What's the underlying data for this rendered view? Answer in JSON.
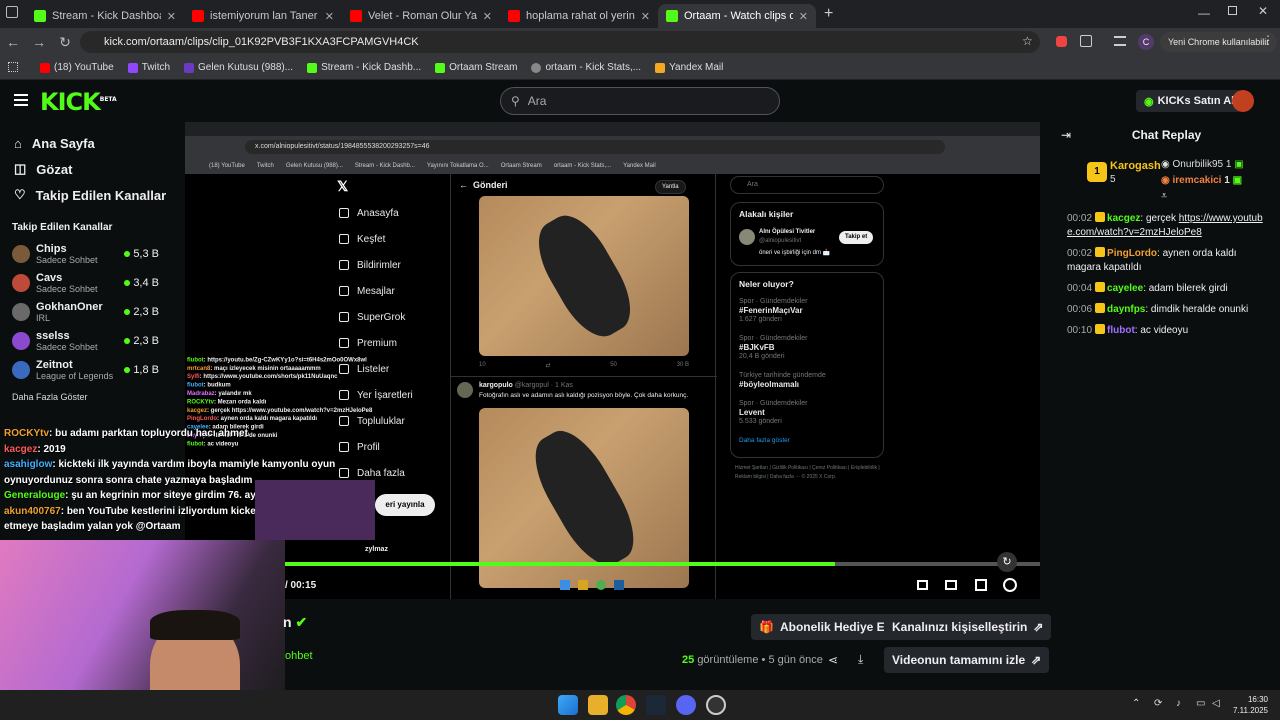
{
  "browser": {
    "tabs": [
      {
        "title": "Stream - Kick Dashboard",
        "color": "#53fc18"
      },
      {
        "title": "istemiyorum lan Taner Tolga Ta",
        "color": "#ff0000"
      },
      {
        "title": "Velet - Roman Olur Yazsam Sen",
        "color": "#ff0000"
      },
      {
        "title": "hoplama rahat ol yerinde otur",
        "color": "#ff0000"
      },
      {
        "title": "Ortaam - Watch clips on Kick",
        "color": "#53fc18"
      }
    ],
    "url": "kick.com/ortaam/clips/clip_01K92PVB3F1KXA3FCPAMGVH4CK",
    "profile_letter": "C",
    "update_label": "Yeni Chrome kullanılabilir",
    "bookmarks": [
      "(18) YouTube",
      "Twitch",
      "Gelen Kutusu (988)...",
      "Stream - Kick Dashb...",
      "Ortaam Stream",
      "ortaam - Kick Stats,...",
      "Yandex Mail"
    ]
  },
  "kick": {
    "logo": "KICK",
    "logo_sup": "BETA",
    "search_placeholder": "Ara",
    "kicks_button": "KICKs Satın Al"
  },
  "sidebar": {
    "nav": [
      "Ana Sayfa",
      "Gözat",
      "Takip Edilen Kanallar"
    ],
    "section_title": "Takip Edilen Kanallar",
    "channels": [
      {
        "name": "Chips",
        "category": "Sadece Sohbet",
        "viewers": "5,3 B",
        "color": "#7a5a3a"
      },
      {
        "name": "Cavs",
        "category": "Sadece Sohbet",
        "viewers": "3,4 B",
        "color": "#c04a3a"
      },
      {
        "name": "GokhanOner",
        "category": "IRL",
        "viewers": "2,3 B",
        "color": "#6a6a6a"
      },
      {
        "name": "sselss",
        "category": "Sadece Sohbet",
        "viewers": "2,3 B",
        "color": "#8a4ad0"
      },
      {
        "name": "Zeitnot",
        "category": "League of Legends",
        "viewers": "1,8 B",
        "color": "#3a6ac0"
      }
    ],
    "show_more": "Daha Fazla Göster"
  },
  "stream": {
    "inner_url": "x.com/alniopulesitivt/status/1984855538200293257s=46",
    "inner_bookmarks": [
      "(18) YouTube",
      "Twitch",
      "Gelen Kutusu (988)...",
      "Stream - Kick Dashb...",
      "Yayınını Tokatlama O...",
      "Ortaam Stream",
      "ortaam - Kick Stats,...",
      "Yandex Mail"
    ],
    "x_nav": [
      "Anasayfa",
      "Keşfet",
      "Bildirimler",
      "Mesajlar",
      "SuperGrok",
      "Premium",
      "Listeler",
      "Yer İşaretleri",
      "Topluluklar",
      "Profil",
      "Daha fazla"
    ],
    "post_button": "eri yayınla",
    "post_header": "Gönderi",
    "reply_label": "Yantla",
    "x_search": "Ara",
    "related_title": "Alakalı kişiler",
    "related_name": "Alnı Öpülesi Tivitler",
    "related_handle": "@alniopulesitivt",
    "related_bio": "öneri ve işbirliği için dm 📩",
    "follow": "Takip et",
    "trends_title": "Neler oluyor?",
    "trends": [
      {
        "cat": "Spor · Gündemdekiler",
        "tag": "#FenerinMaçıVar",
        "count": "1.627 gönderi"
      },
      {
        "cat": "Spor · Gündemdekiler",
        "tag": "#BJKvFB",
        "count": "20,4 B gönderi"
      },
      {
        "cat": "Türkiye tarihinde gündemde",
        "tag": "#böyleolmamalı",
        "count": ""
      },
      {
        "cat": "Spor · Gündemdekiler",
        "tag": "Levent",
        "count": "5.533 gönderi"
      }
    ],
    "show_more": "Daha fazla göster",
    "footer": "Hizmet Şartları | Gizlilik Politikası | Çerez Politikası | Erişilebilirlik | Reklam bilgisi | Daha fazla ··· © 2025 X Corp.",
    "tweet_stats": [
      "10",
      "",
      "50",
      "30 B"
    ],
    "reply_user": "kargopulo",
    "reply_handle": "@kargopul · 1 Kas",
    "reply_text": "Fotoğrafın aslı ve adamın aslı kaldığı pozisyon böyle. Çok daha korkunç.",
    "time": "/ 00:15",
    "user_tag": "zylmaz",
    "progress": 0.76
  },
  "overlay_chat": [
    {
      "user": "flubot",
      "text": ": https://youtu.be/Zg-CZwKYy1o?si=t6H4s2mOo0OWx8wl"
    },
    {
      "user": "mrtcan8",
      "text": ": maçı izleyecek misinin ortaaaaammm"
    },
    {
      "user": "Sylfi",
      "text": ": https://www.youtube.com/shorts/pk11NuUaqnc"
    },
    {
      "user": "flubot",
      "text": ": budkum"
    },
    {
      "user": "Madrabaz",
      "text": ": yalandır mk"
    },
    {
      "user": "ROCKYtv",
      "text": ": Mezarı orda kaldı"
    },
    {
      "user": "kacgez",
      "text": ": gerçek https://www.youtube.com/watch?v=2mzHJeloPe8"
    },
    {
      "user": "PingLordo",
      "text": ": aynen orda kaldı magara kapatıldı"
    },
    {
      "user": "cayelee",
      "text": ": adam bilerek girdi"
    },
    {
      "user": "daynfps",
      "text": ": dimdik heralde onunki"
    },
    {
      "user": "flubot",
      "text": ": ac videoyu"
    }
  ],
  "big_overlay": [
    {
      "user": "ROCKYtv",
      "text": ": bu adamı parktan topluyordu hacı ahmet"
    },
    {
      "user": "kacgez",
      "text": ": 2019"
    },
    {
      "user": "asahiglow",
      "text": ": kickteki ilk yayında vardım iboyla mamiyle kamyonlu oyun"
    },
    {
      "user": "",
      "text": "oynuyordunuz sonra sonra chate yazmaya başladım"
    },
    {
      "user": "Generalouge",
      "text": ": şu an kegrinin mor siteye girdim 76. ayı kutlatıyo mesela"
    },
    {
      "user": "akun400767",
      "text": ": ben YouTube kestlerini izliyordum kicke geçince takip"
    },
    {
      "user": "",
      "text": "etmeye başladım yalan yok @Ortaam"
    }
  ],
  "chat": {
    "title": "Chat Replay",
    "top_gifter": {
      "name": "Karogash",
      "count": "5",
      "rank": "1"
    },
    "leaders": [
      {
        "name": "Onurbilik95",
        "count": "1"
      },
      {
        "name": "iremcakici",
        "count": "1"
      }
    ],
    "messages": [
      {
        "time": "00:02",
        "user": "kacgez",
        "color": "#53fc18",
        "text": ": gerçek ",
        "link": "https://www.youtube.com/watch?v=2mzHJeloPe8"
      },
      {
        "time": "00:02",
        "user": "PingLordo",
        "color": "#f0a030",
        "text": ": aynen orda kaldı magara kapatıldı",
        "link": ""
      },
      {
        "time": "00:04",
        "user": "cayelee",
        "color": "#53fc18",
        "text": ": adam bilerek girdi",
        "link": ""
      },
      {
        "time": "00:06",
        "user": "daynfps",
        "color": "#53fc18",
        "text": ": dimdik heralde onunki",
        "link": ""
      },
      {
        "time": "00:10",
        "user": "flubot",
        "color": "#a070ff",
        "text": ": ac videoyu",
        "link": ""
      }
    ]
  },
  "below": {
    "title_frag": "n",
    "sub_frag": "ohbet",
    "gift": "Abonelik Hediye Et",
    "customize": "Kanalınızı kişiselleştirin",
    "views_num": "25",
    "views_label": "görüntüleme",
    "ago": "• 5 gün önce",
    "watch_full": "Videonun tamamını izle"
  },
  "taskbar": {
    "time": "16:30",
    "date": "7.11.2025"
  }
}
